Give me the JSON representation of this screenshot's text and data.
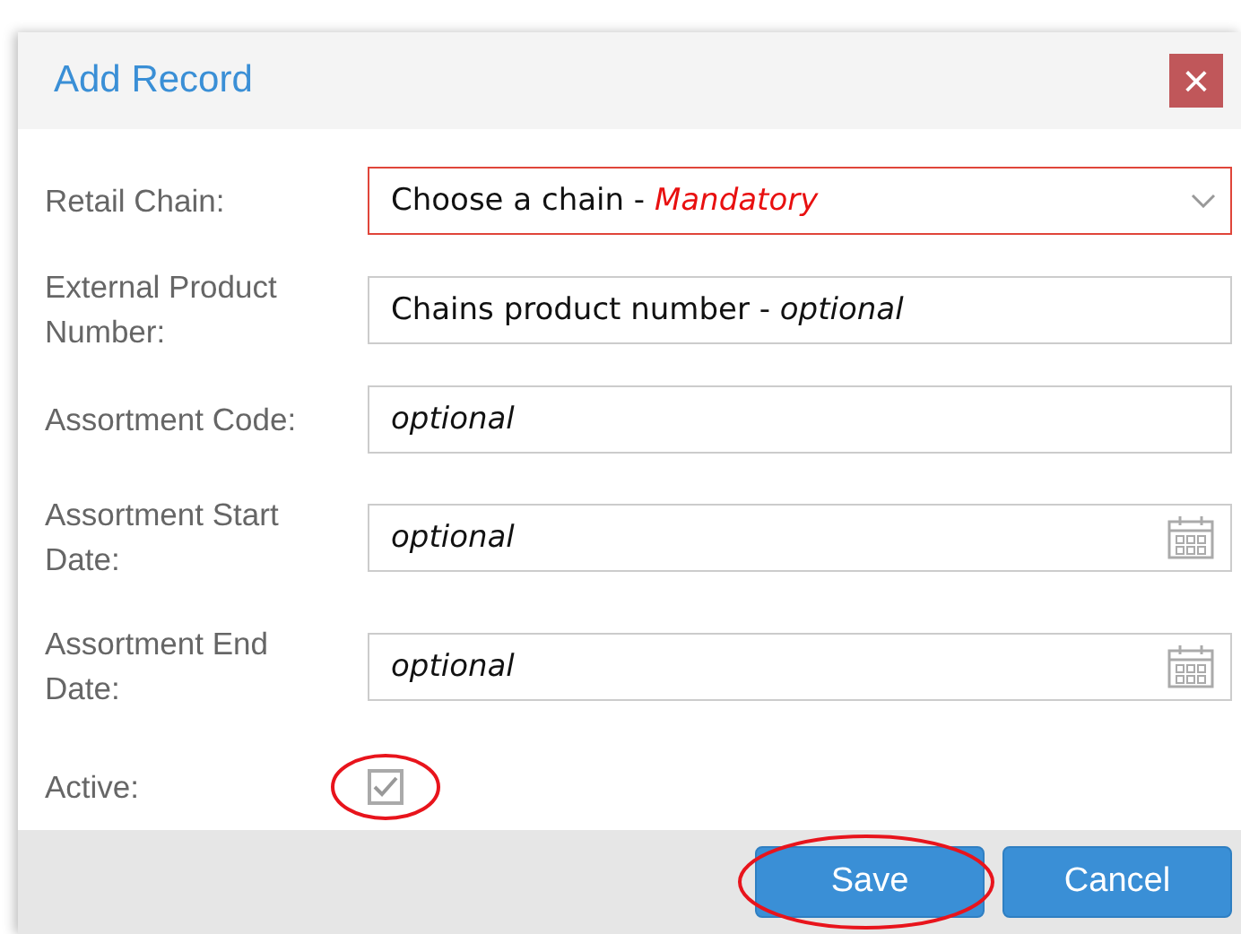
{
  "dialog": {
    "title": "Add Record",
    "close": "×"
  },
  "fields": [
    {
      "kind": "select",
      "label": "Retail Chain:",
      "value": "Choose a chain - *Mandatory*",
      "invalid": true
    },
    {
      "kind": "text",
      "label": "External Product Number:",
      "value": "Chains product number - *optional*",
      "invalid": false
    },
    {
      "kind": "text",
      "label": "Assortment Code:",
      "value": "*optional*",
      "invalid": false
    },
    {
      "kind": "date",
      "label": "Assortment Start Date:",
      "value": "*optional*",
      "invalid": false
    },
    {
      "kind": "date",
      "label": "Assortment End Date:",
      "value": "*optional*",
      "invalid": false
    },
    {
      "kind": "checkbox",
      "label": "Active:",
      "checked": true,
      "disabled": true,
      "circled": true
    }
  ],
  "buttons": [
    {
      "label": "Save",
      "circled": true
    },
    {
      "label": "Cancel",
      "circled": false
    }
  ]
}
